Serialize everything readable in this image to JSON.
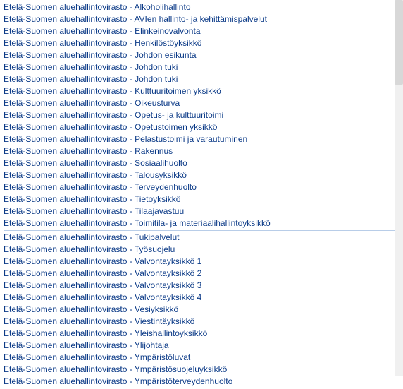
{
  "prefix": "Etelä-Suomen aluehallintovirasto - ",
  "items": [
    "Alkoholihallinto",
    "AVIen hallinto- ja kehittämispalvelut",
    "Elinkeinovalvonta",
    "Henkilöstöyksikkö",
    "Johdon esikunta",
    "Johdon tuki",
    "Johdon tuki",
    "Kulttuuritoimen yksikkö",
    "Oikeusturva",
    "Opetus- ja kulttuuritoimi",
    "Opetustoimen yksikkö",
    "Pelastustoimi ja varautuminen",
    "Rakennus",
    "Sosiaalihuolto",
    "Talousyksikkö",
    "Terveydenhuolto",
    "Tietoyksikkö",
    "Tilaajavastuu",
    "Toimitila- ja materiaalihallintoyksikkö",
    "Tukipalvelut",
    "Työsuojelu",
    "Valvontayksikkö 1",
    "Valvontayksikkö 2",
    "Valvontayksikkö 3",
    "Valvontayksikkö 4",
    "Vesiyksikkö",
    "Viestintäyksikkö",
    "Yleishallintoyksikkö",
    "Ylijohtaja",
    "Ympäristöluvat",
    "Ympäristösuojeluyksikkö",
    "Ympäristöterveydenhuolto"
  ],
  "divider_after_index": 18
}
